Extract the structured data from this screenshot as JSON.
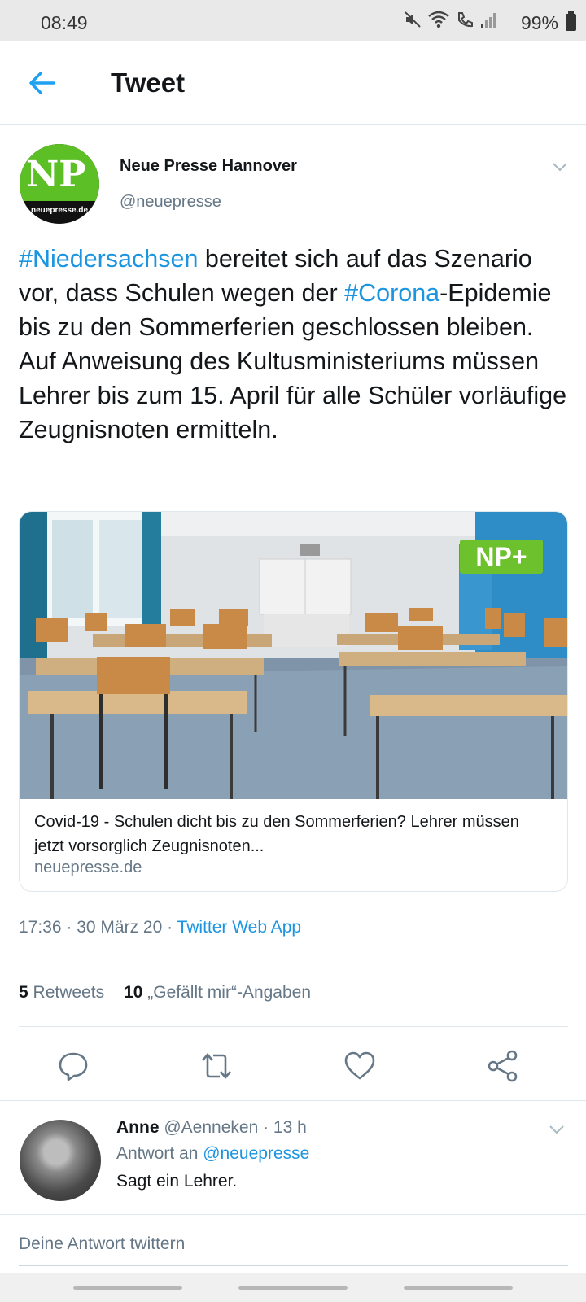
{
  "status_bar": {
    "time": "08:49",
    "battery": "99%",
    "icons": [
      "mute-icon",
      "wifi-icon",
      "call-icon",
      "signal-icon",
      "battery-icon"
    ]
  },
  "header": {
    "title": "Tweet",
    "back_icon": "arrow-left-icon"
  },
  "tweet": {
    "author_name": "Neue Presse Hannover",
    "author_handle": "@neuepresse",
    "avatar_text": "NP",
    "avatar_subtext": "neuepresse.de",
    "text_parts": {
      "hashtag1": "#Niedersachsen",
      "part1": " bereitet sich auf das Szenario vor, dass Schulen wegen der ",
      "hashtag2": "#Corona",
      "part2": "-Epidemie bis zu den Sommerferien geschlossen bleiben. Auf Anweisung des Kultusministeriums müssen Lehrer bis zum 15. April für alle Schüler vorläufige Zeugnisnoten ermitteln."
    },
    "card": {
      "badge": "NP+",
      "title": "Covid-19 - Schulen dicht bis zu den Sommerferien? Lehrer müssen jetzt vorsorglich Zeugnisnoten...",
      "domain": "neuepresse.de"
    },
    "timestamp": "17:36 · 30 März 20 · ",
    "source": "Twitter Web App",
    "retweets_count": "5",
    "retweets_label": "Retweets",
    "likes_count": "10",
    "likes_label": "„Gefällt mir“-Angaben"
  },
  "actions": [
    "reply-icon",
    "retweet-icon",
    "like-icon",
    "share-icon"
  ],
  "reply": {
    "name": "Anne",
    "handle_time": "@Aenneken · 13 h",
    "reply_to_label": "Antwort an ",
    "reply_to_handle": "@neuepresse",
    "text": "Sagt ein Lehrer."
  },
  "composer": {
    "placeholder": "Deine Antwort twittern"
  },
  "colors": {
    "accent": "#1b95e0",
    "np_green": "#5cbf25",
    "muted": "#657786"
  }
}
